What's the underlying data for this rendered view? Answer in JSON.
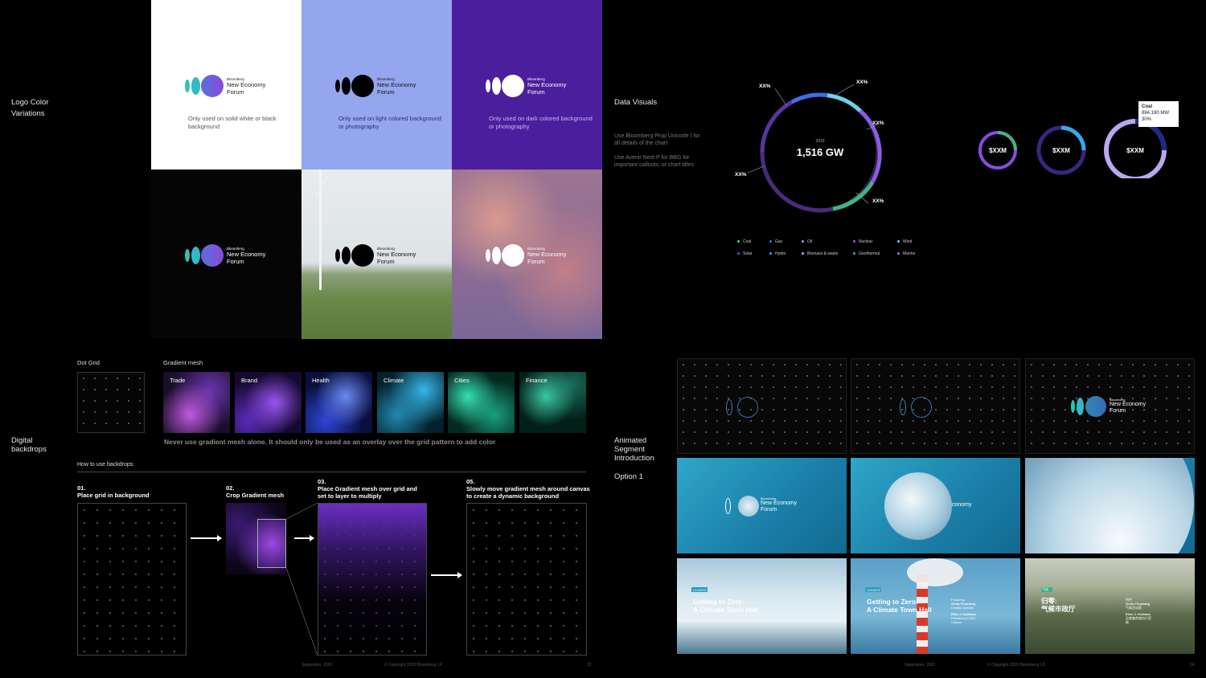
{
  "logo_section": {
    "label_line1": "Logo Color",
    "label_line2": "Variations",
    "brand_small": "Bloomberg",
    "brand_line1": "New Economy",
    "brand_line2": "Forum",
    "tiles": [
      {
        "note": "Only used on solid white or black background"
      },
      {
        "note": "Only used on light colored background or photography"
      },
      {
        "note": "Only used on dark colored background or photography"
      }
    ]
  },
  "data_visuals": {
    "label": "Data Visuals",
    "desc1": "Use Bloomberg Prop Unicode I for all details of the chart",
    "desc2": "Use Avenir Next P for BBG for important callouts, or chart titles",
    "center_year": "2019",
    "center_value": "1,516 GW",
    "callouts": [
      "XX%",
      "XX%",
      "XX%",
      "XX%",
      "XX%"
    ],
    "small_values": [
      "$XXM",
      "$XXM",
      "$XXM"
    ],
    "tooltip": {
      "title": "Coal",
      "value": "884,190 MW",
      "pct": "30%"
    },
    "legend": [
      "Coal",
      "Gas",
      "Oil",
      "Nuclear",
      "Wind",
      "Solar",
      "Hydro",
      "Biomass & waste",
      "Geothermal",
      "Marine"
    ],
    "legend_colors": [
      "#4bd0a0",
      "#3b6fe8",
      "#8fa4f0",
      "#8a5ae8",
      "#6ad3e8",
      "#6b4ae0",
      "#3aa7f0",
      "#b9a8ff",
      "#3db48a",
      "#8f7bf8"
    ]
  },
  "backdrops": {
    "label_line1": "Digital",
    "label_line2": "backdrops",
    "dot_grid_label": "Dot Grid",
    "gradient_label": "Gradient mesh",
    "meshes": [
      "Trade",
      "Brand",
      "Health",
      "Climate",
      "Cities",
      "Finance"
    ],
    "warning": "Never use gradient mesh alone. It should only be used as an overlay over the grid pattern to add color",
    "how_to": "How to use backdrops:",
    "steps": [
      {
        "num": "01.",
        "text": "Place grid in background"
      },
      {
        "num": "02.",
        "text": "Crop Gradient mesh"
      },
      {
        "num": "03.",
        "text": "Place Gradient mesh over grid and set to layer to multiply"
      },
      {
        "num": "05.",
        "text": "Slowly move gradient mesh around canvas to create a dynamic background"
      }
    ]
  },
  "animated": {
    "label_line1": "Animated",
    "label_line2": "Segment",
    "label_line3": "Introduction",
    "option": "Option 1",
    "f4_brand": "Bloomberg",
    "f4_line1": "New Economy",
    "f4_line2": "Forum",
    "f5_partial": "conomy",
    "f7_tag": "CLIMATE",
    "f7_title1": "Getting to Zero:",
    "f7_title2": "A Climate Town Hall",
    "f8_tag": "CLIMATE",
    "f8_title1": "Getting to Zero:",
    "f8_title2": "A Climate Town Hall",
    "f8_featuring": "Featuring",
    "f8_p1_name": "Greta Thunberg",
    "f8_p1_role": "Climate Activist",
    "f8_p2_name": "Ellen J. Kullman",
    "f8_p2_role": "President & CEO",
    "f8_p2_org": "Carbon",
    "f9_tag": "气候",
    "f9_title1": "归零:",
    "f9_title2": "气候市政厅",
    "f9_featuring": "特色",
    "f9_p1_name": "Greta Thunberg",
    "f9_p1_role": "气候活动家",
    "f9_p2_name": "Ellen J. Kullman",
    "f9_p2_role": "总裁兼首席执行官",
    "f9_p2_org": "碳"
  },
  "footer": {
    "date": "September, 2020",
    "copyright": "© Copyright 2020 Bloomberg LP.",
    "page_left": "22",
    "page_right": "24"
  }
}
